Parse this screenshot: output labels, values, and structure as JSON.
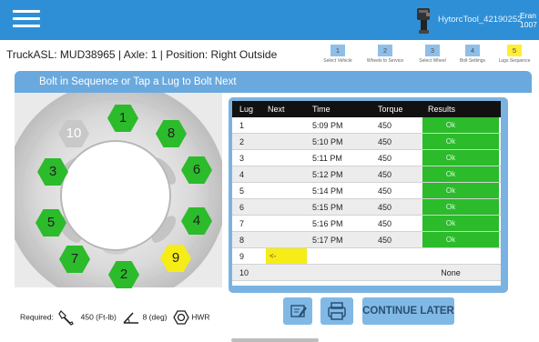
{
  "header": {
    "tool_name": "HytorcTool_42190252",
    "user_line1": "Eran",
    "user_line2": "1007"
  },
  "info": {
    "title": "TruckASL: MUD38965 |  Axle: 1 | Position: Right Outside"
  },
  "steps": [
    {
      "num": "1",
      "label": "Select Vehicle",
      "active": false
    },
    {
      "num": "2",
      "label": "Wheels to Service",
      "active": false
    },
    {
      "num": "3",
      "label": "Select Wheel",
      "active": false
    },
    {
      "num": "4",
      "label": "Bolt Settings",
      "active": false
    },
    {
      "num": "5",
      "label": "Lugs Sequence",
      "active": true
    }
  ],
  "instruction": "Bolt in Sequence or Tap a Lug to Bolt Next",
  "wheel_lugs": [
    {
      "label": "1",
      "state": "done"
    },
    {
      "label": "8",
      "state": "done"
    },
    {
      "label": "6",
      "state": "done"
    },
    {
      "label": "4",
      "state": "done"
    },
    {
      "label": "9",
      "state": "next"
    },
    {
      "label": "2",
      "state": "done"
    },
    {
      "label": "7",
      "state": "done"
    },
    {
      "label": "5",
      "state": "done"
    },
    {
      "label": "3",
      "state": "done"
    },
    {
      "label": "10",
      "state": "pending"
    }
  ],
  "table": {
    "headers": {
      "lug": "Lug",
      "next": "Next",
      "time": "Time",
      "torque": "Torque",
      "results": "Results"
    },
    "rows": [
      {
        "lug": "1",
        "next": "",
        "time": "5:09 PM",
        "torque": "450",
        "result": "Ok"
      },
      {
        "lug": "2",
        "next": "",
        "time": "5:10 PM",
        "torque": "450",
        "result": "Ok"
      },
      {
        "lug": "3",
        "next": "",
        "time": "5:11 PM",
        "torque": "450",
        "result": "Ok"
      },
      {
        "lug": "4",
        "next": "",
        "time": "5:12 PM",
        "torque": "450",
        "result": "Ok"
      },
      {
        "lug": "5",
        "next": "",
        "time": "5:14 PM",
        "torque": "450",
        "result": "Ok"
      },
      {
        "lug": "6",
        "next": "",
        "time": "5:15 PM",
        "torque": "450",
        "result": "Ok"
      },
      {
        "lug": "7",
        "next": "",
        "time": "5:16 PM",
        "torque": "450",
        "result": "Ok"
      },
      {
        "lug": "8",
        "next": "",
        "time": "5:17 PM",
        "torque": "450",
        "result": "Ok"
      },
      {
        "lug": "9",
        "next": "<-",
        "time": "",
        "torque": "",
        "result": ""
      },
      {
        "lug": "10",
        "next": "",
        "time": "",
        "torque": "",
        "result": "None"
      }
    ]
  },
  "required": {
    "label": "Required:",
    "torque": "450 (Ft-lb)",
    "angle": "8 (deg)",
    "nut": "HWR"
  },
  "buttons": {
    "continue_later": "CONTINUE LATER"
  },
  "colors": {
    "app_bar": "#2f8fd6",
    "ok_green": "#2bbb2b",
    "next_yellow": "#f6ec17",
    "pending_grey": "#c8c8c8",
    "button_blue": "#80b9e6"
  }
}
